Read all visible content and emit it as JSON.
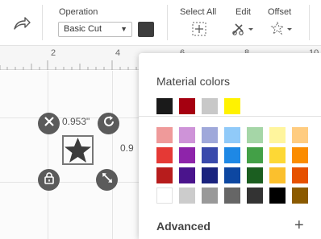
{
  "toolbar": {
    "operation_label": "Operation",
    "operation_value": "Basic Cut",
    "operation_color": "#3d3d3d",
    "select_all_label": "Select All",
    "edit_label": "Edit",
    "offset_label": "Offset"
  },
  "ruler": {
    "ticks": [
      "2",
      "4",
      "6",
      "8",
      "10"
    ]
  },
  "canvas": {
    "width_readout": "0.953\"",
    "height_readout": "0.9"
  },
  "material_colors": {
    "title": "Material colors",
    "recent": [
      "#1a1a1a",
      "#a50010",
      "#c8c8c8",
      "#fff200"
    ],
    "palette": [
      [
        "#ef9a9a",
        "#ce93d8",
        "#9fa8da",
        "#90caf9",
        "#a5d6a7",
        "#fff59d",
        "#ffcc80"
      ],
      [
        "#e53935",
        "#8e24aa",
        "#3949ab",
        "#1e88e5",
        "#43a047",
        "#fdd835",
        "#fb8c00"
      ],
      [
        "#b71c1c",
        "#4a148c",
        "#1a237e",
        "#0d47a1",
        "#1b5e20",
        "#fbc02d",
        "#e65100"
      ],
      [
        "#ffffff",
        "#cccccc",
        "#999999",
        "#666666",
        "#333333",
        "#000000",
        "#8b5a00"
      ]
    ],
    "advanced_label": "Advanced",
    "advanced_toggle": "+"
  }
}
